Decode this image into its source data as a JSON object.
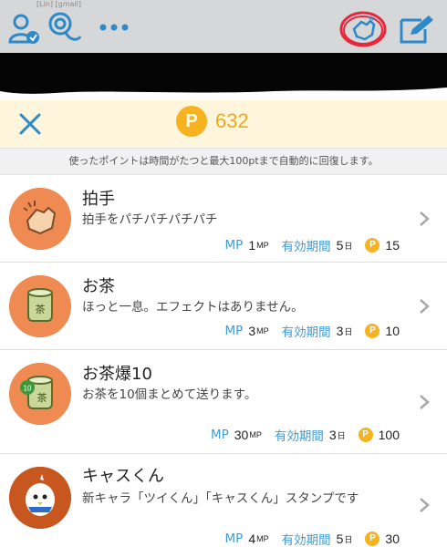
{
  "header": {
    "status_text": "[Lin] [gmail]",
    "icons": [
      "user-icon",
      "phone-icon",
      "more-icon",
      "clap-icon",
      "compose-icon"
    ]
  },
  "points": {
    "value": "632",
    "coin_letter": "P",
    "notice": "使ったポイントは時間がたつと最大100ptまで自動的に回復します。"
  },
  "items": [
    {
      "title": "拍手",
      "desc": "拍手をパチパチパチパチ",
      "mp_label": "MP",
      "mp": "1",
      "mp_unit": "MP",
      "period_label": "有効期間",
      "period": "5",
      "period_unit": "日",
      "cost": "15"
    },
    {
      "title": "お茶",
      "desc": "ほっと一息。エフェクトはありません。",
      "mp_label": "MP",
      "mp": "3",
      "mp_unit": "MP",
      "period_label": "有効期間",
      "period": "3",
      "period_unit": "日",
      "cost": "10"
    },
    {
      "title": "お茶爆10",
      "desc": "お茶を10個まとめて送ります。",
      "mp_label": "MP",
      "mp": "30",
      "mp_unit": "MP",
      "period_label": "有効期間",
      "period": "3",
      "period_unit": "日",
      "cost": "100",
      "badge": "10"
    },
    {
      "title": "キャスくん",
      "desc": "新キャラ「ツイくん」「キャスくん」スタンプです",
      "mp_label": "MP",
      "mp": "4",
      "mp_unit": "MP",
      "period_label": "有効期間",
      "period": "5",
      "period_unit": "日",
      "cost": "30"
    }
  ],
  "colors": {
    "accent_blue": "#3f9bd3",
    "coin_gold": "#f7b21f",
    "icon_bg": "#ee8a52",
    "highlight_red": "#e8283c"
  }
}
